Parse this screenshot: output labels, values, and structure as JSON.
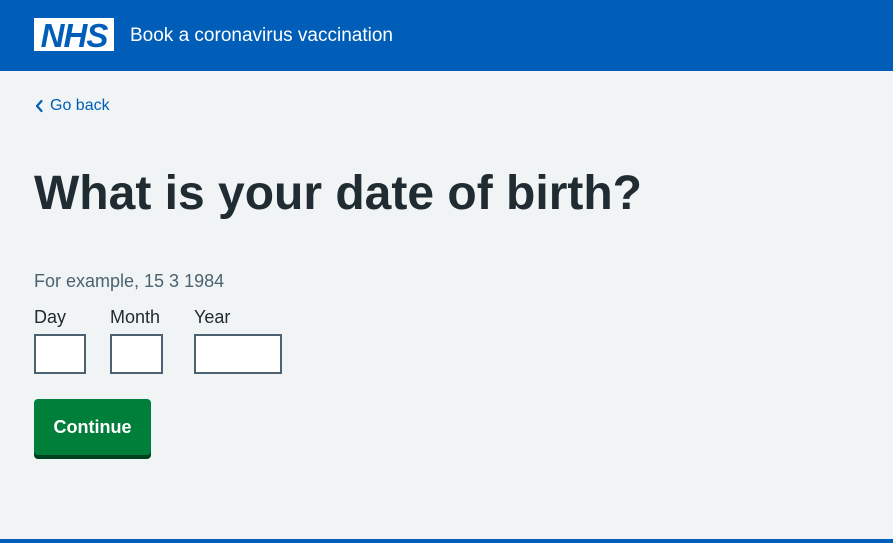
{
  "header": {
    "logo_text": "NHS",
    "service_name": "Book a coronavirus vaccination",
    "background_color": "#005eb8"
  },
  "back_link": {
    "label": "Go back",
    "icon": "chevron-left-icon"
  },
  "page": {
    "title": "What is your date of birth?",
    "hint": "For example, 15 3 1984"
  },
  "date_fields": {
    "day": {
      "label": "Day",
      "value": ""
    },
    "month": {
      "label": "Month",
      "value": ""
    },
    "year": {
      "label": "Year",
      "value": ""
    }
  },
  "actions": {
    "continue_label": "Continue",
    "continue_color": "#007f3b"
  }
}
